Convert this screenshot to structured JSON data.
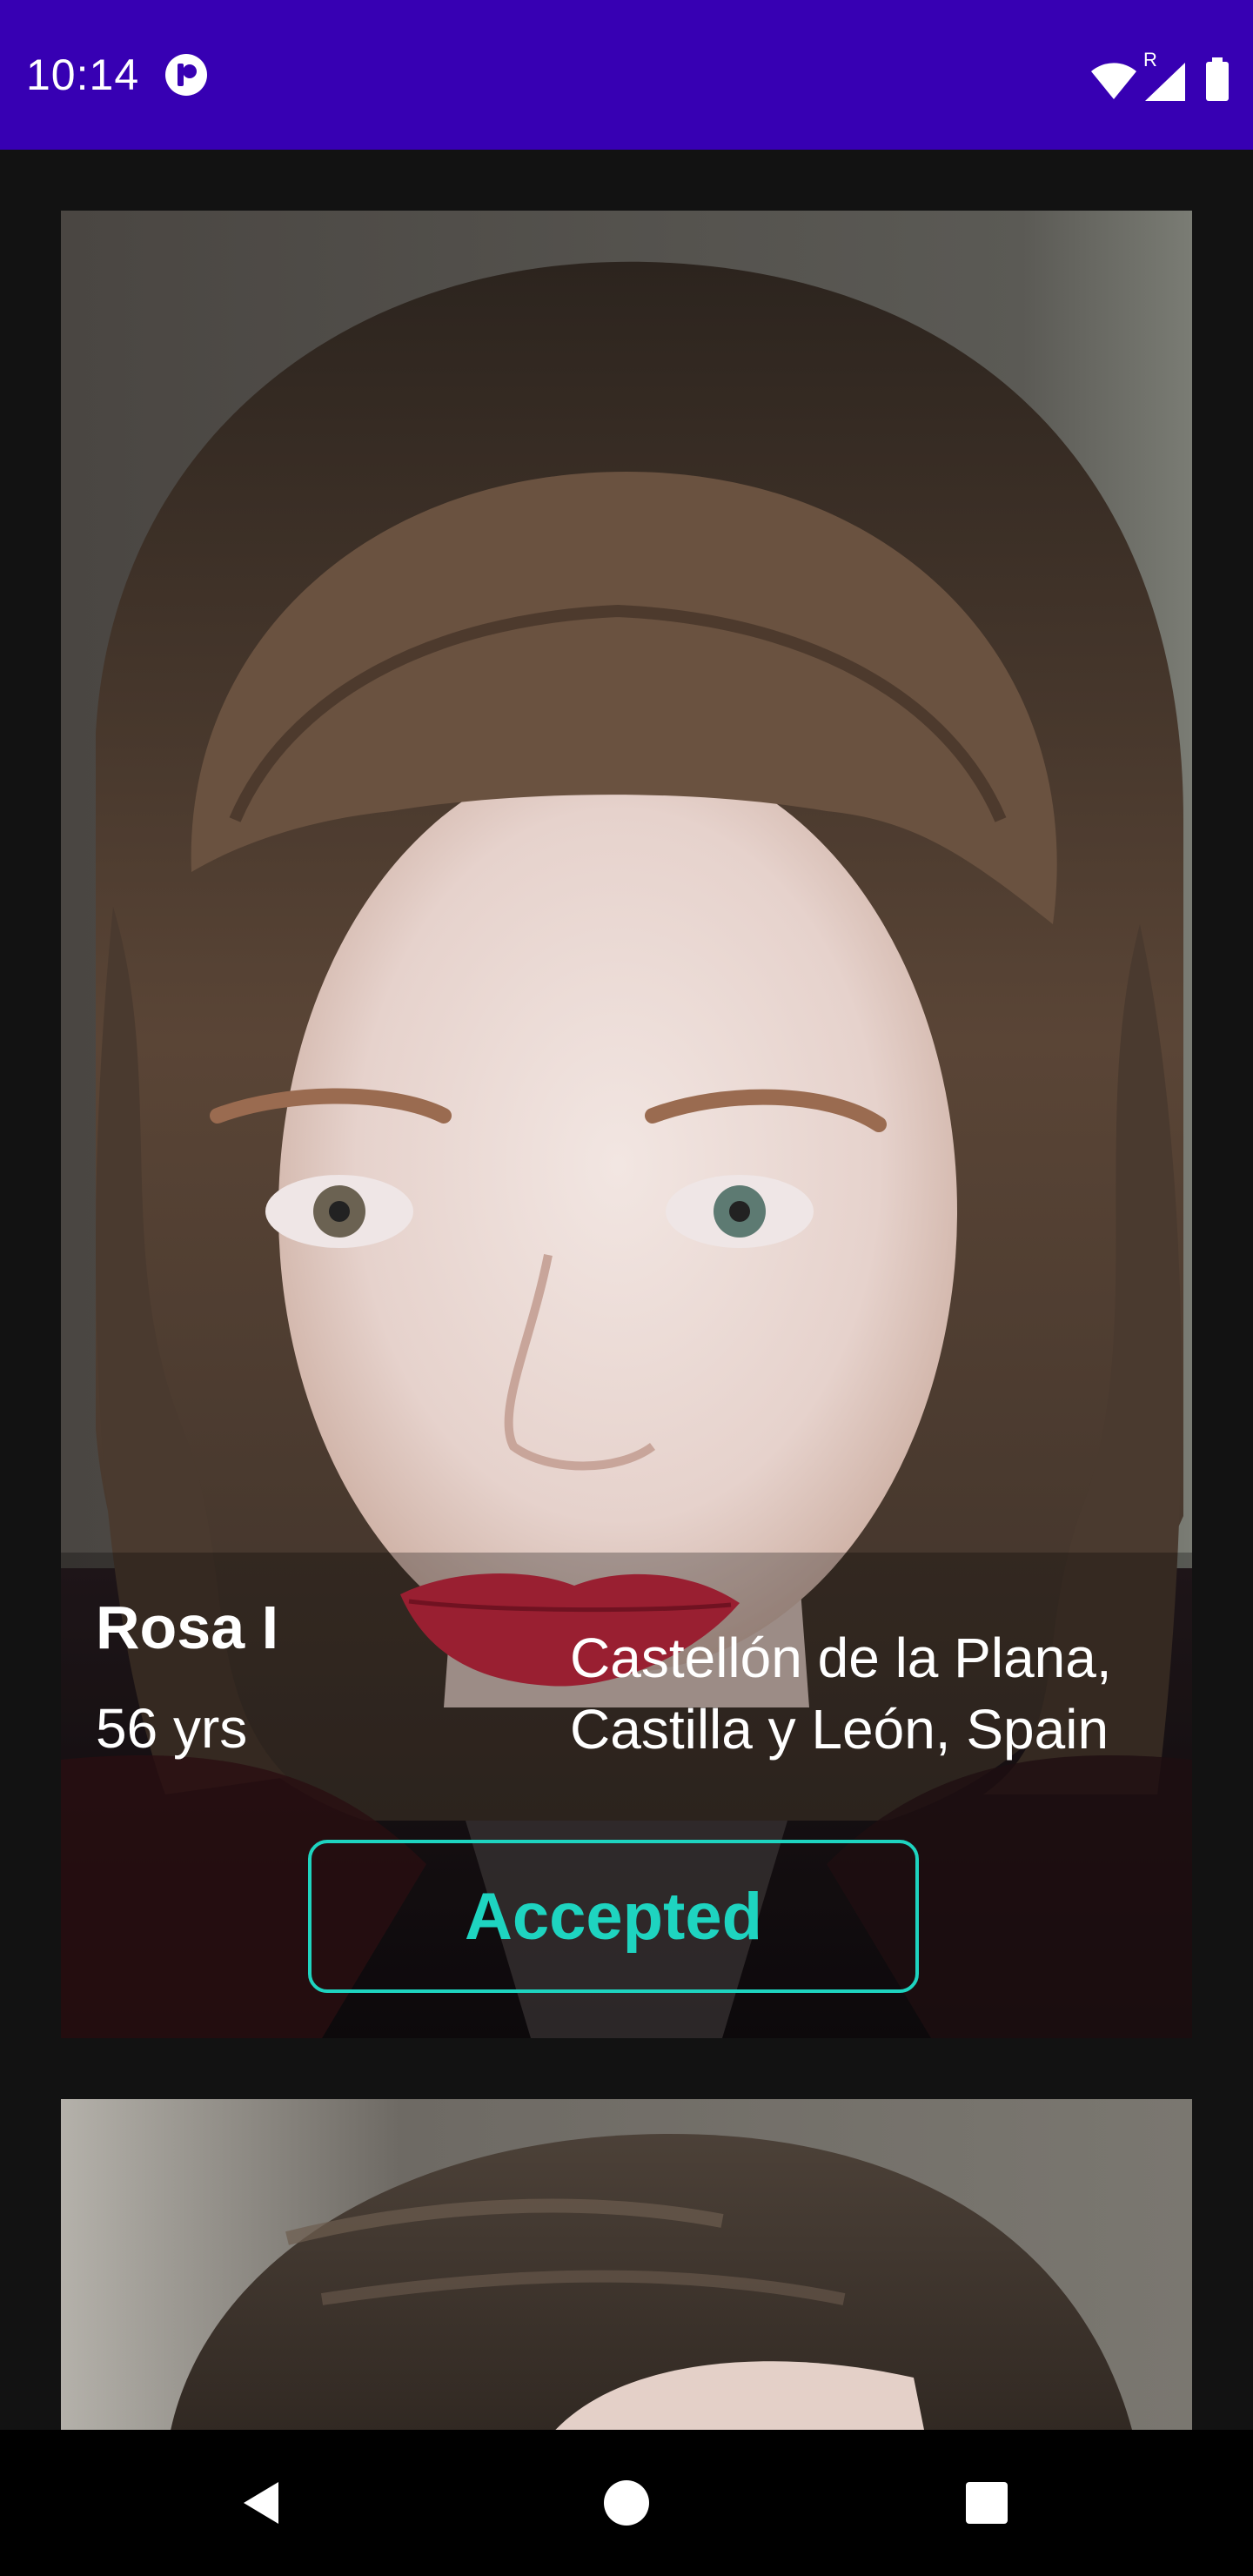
{
  "status_bar": {
    "time": "10:14",
    "background": "#3700b3",
    "icons": [
      "app-notification-icon",
      "wifi-icon",
      "cell-signal-icon",
      "battery-icon"
    ],
    "roaming_label": "R"
  },
  "cards": [
    {
      "name": "Rosa I",
      "age": "56 yrs",
      "location": "Castellón de la Plana, Castilla y León, Spain",
      "status_label": "Accepted",
      "status_color": "#1ed4c0"
    }
  ],
  "navigation": {
    "icons": [
      "back-icon",
      "home-icon",
      "recents-icon"
    ]
  }
}
